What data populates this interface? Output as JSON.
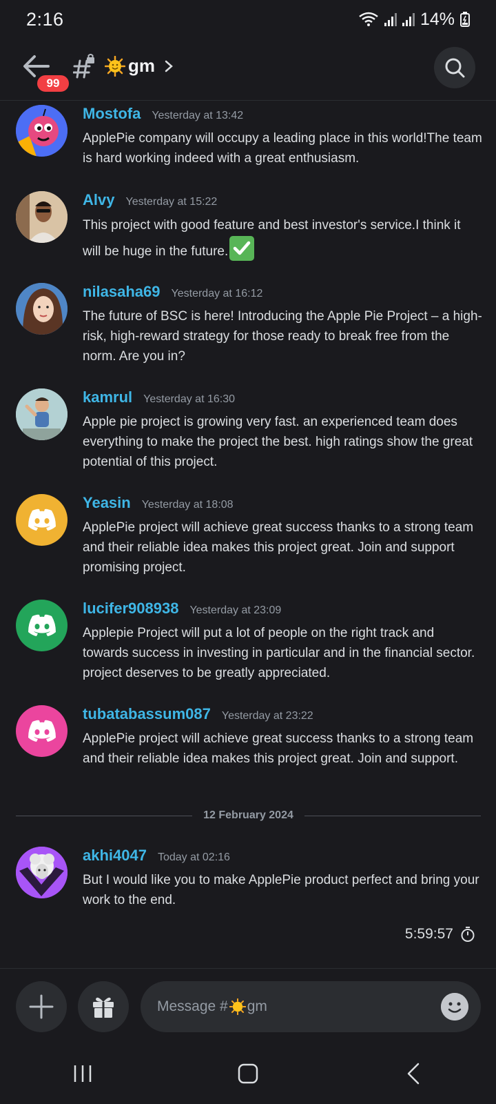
{
  "status_bar": {
    "time": "2:16",
    "battery": "14%"
  },
  "header": {
    "badge_count": "99",
    "channel_name": "gm",
    "channel_icon": "hash-locked-icon",
    "channel_emoji": "sun-emoji"
  },
  "messages": [
    {
      "author": "Mostofa",
      "time": "Yesterday at 13:42",
      "text": "ApplePie company will occupy a leading place in this world!The team is hard working indeed with a great enthusiasm."
    },
    {
      "author": "Alvy",
      "time": "Yesterday at 15:22",
      "text": "This project with good feature and best investor's service.I think it will be huge in the future."
    },
    {
      "author": "nilasaha69",
      "time": "Yesterday at 16:12",
      "text": "The future of BSC is here! Introducing the Apple Pie Project – a high-risk, high-reward strategy for those ready to break free from the norm. Are you in?"
    },
    {
      "author": "kamrul",
      "time": "Yesterday at 16:30",
      "text": "Apple pie  project is growing very fast. an experienced team does everything to make the project the best. high ratings show the great potential of this project."
    },
    {
      "author": "Yeasin",
      "time": "Yesterday at 18:08",
      "text": "ApplePie project will achieve great success thanks to a strong team and their reliable idea makes this project great. Join and support promising project."
    },
    {
      "author": "lucifer908938",
      "time": "Yesterday at 23:09",
      "text": "Applepie Project will put a lot of people on the right track and towards success in investing in particular and in the financial sector. project deserves to be greatly appreciated."
    },
    {
      "author": "tubatabassum087",
      "time": "Yesterday at 23:22",
      "text": "ApplePie project will achieve great success thanks to a strong team and their reliable idea makes this project great. Join and support."
    },
    {
      "author": "akhi4047",
      "time": "Today at 02:16",
      "text": "But I would like you to make ApplePie product perfect and bring your work to the end."
    }
  ],
  "date_divider": "12 February 2024",
  "slowmode_timer": "5:59:57",
  "composer": {
    "placeholder_prefix": "Message #",
    "placeholder_channel": "gm"
  },
  "colors": {
    "background": "#1a1a1e",
    "author": "#3fb6e6",
    "timestamp": "#949ba4",
    "badge": "#f23f43",
    "input_bg": "#2b2d31"
  }
}
